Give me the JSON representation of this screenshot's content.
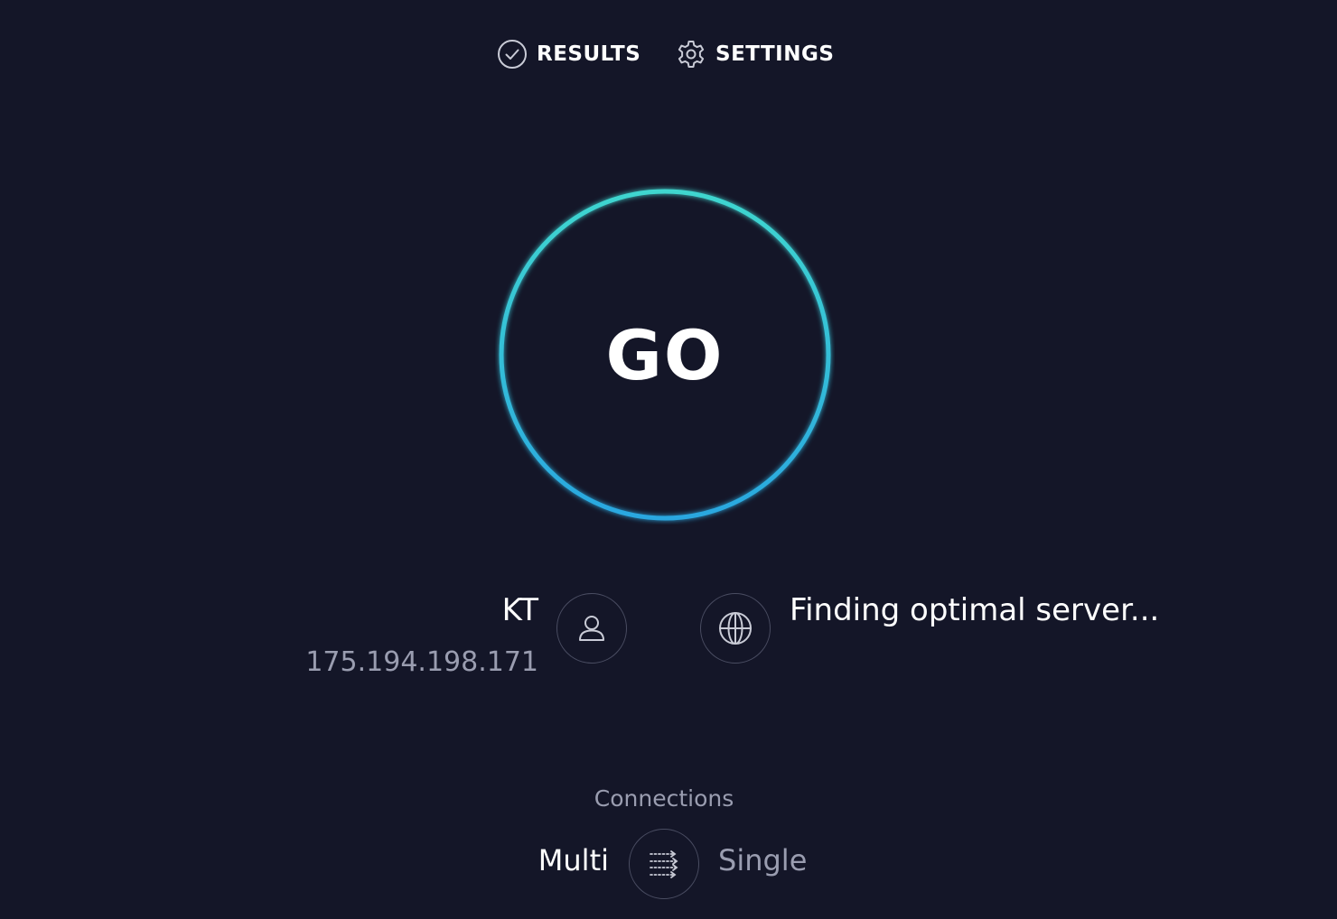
{
  "nav": {
    "results_label": "RESULTS",
    "results_icon": "check-circle-icon",
    "settings_label": "SETTINGS",
    "settings_icon": "gear-icon"
  },
  "go_button": {
    "label": "GO",
    "ring_color_top": "#3fd6cf",
    "ring_color_bottom": "#2aa7e0"
  },
  "isp": {
    "name": "KT",
    "ip": "175.194.198.171",
    "icon": "user-icon"
  },
  "server": {
    "status": "Finding optimal server...",
    "icon": "globe-icon"
  },
  "connections": {
    "title": "Connections",
    "multi_label": "Multi",
    "single_label": "Single",
    "icon": "connections-toggle-icon"
  },
  "colors": {
    "background": "#141628",
    "text_primary": "#ffffff",
    "text_secondary": "#9a9db0"
  }
}
